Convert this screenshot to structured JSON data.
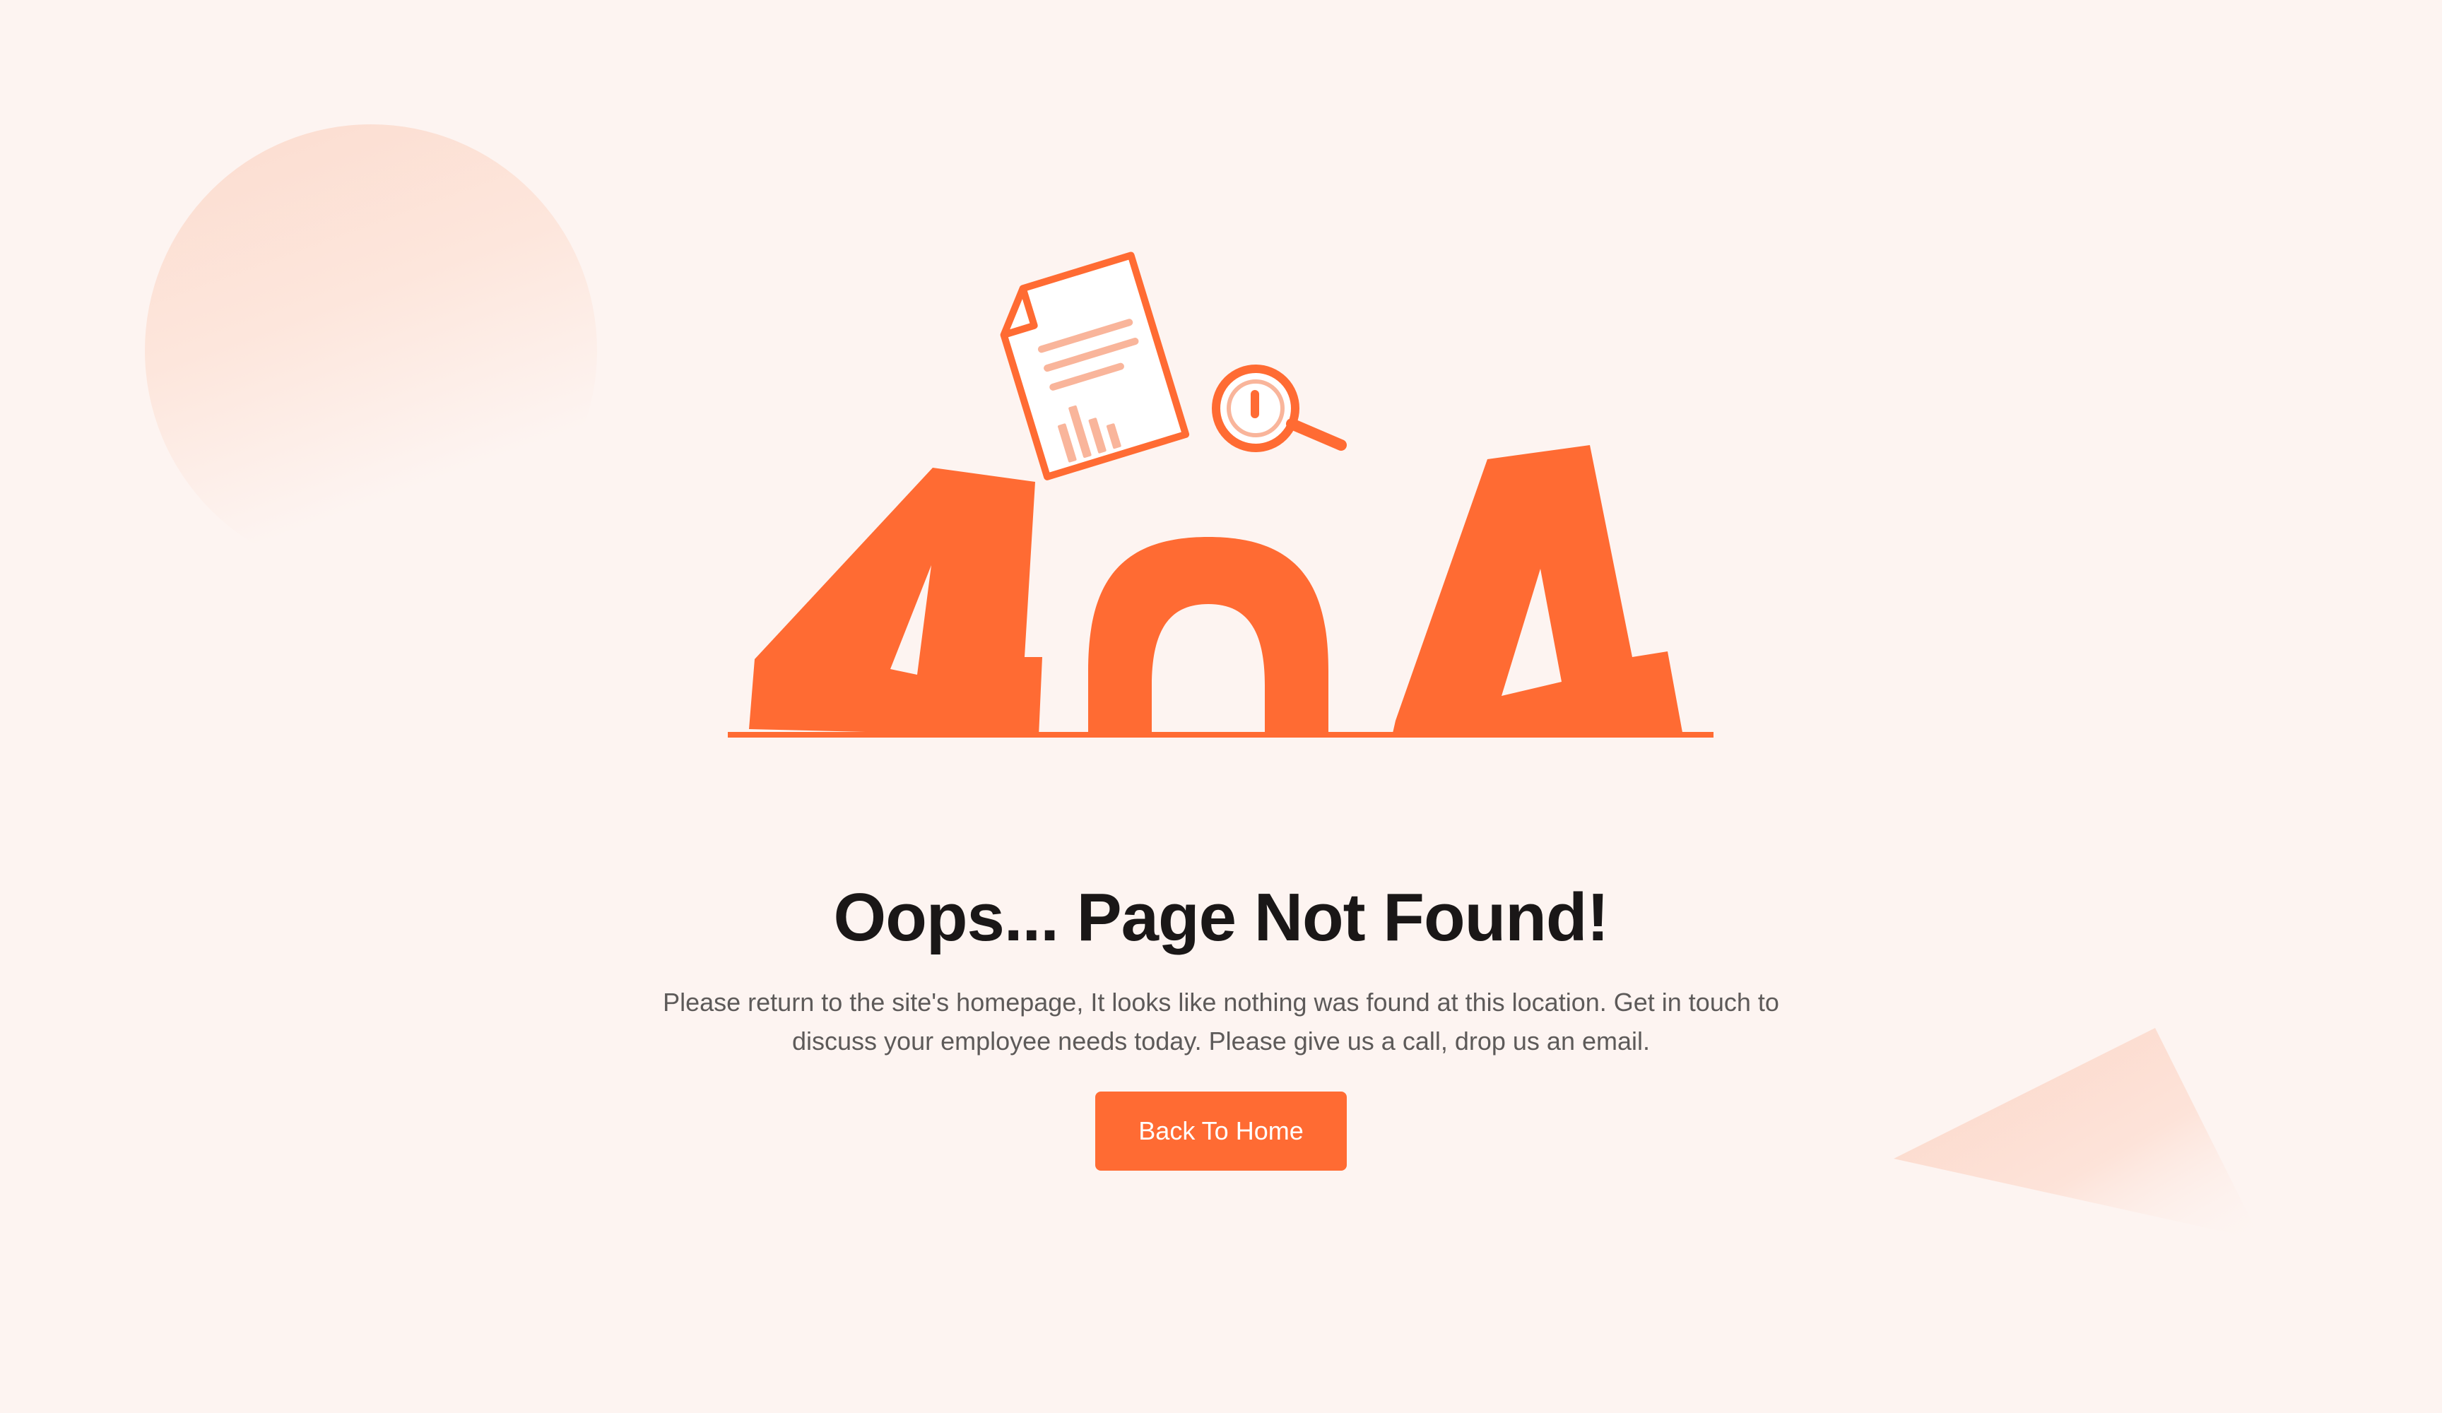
{
  "error": {
    "code_text": "404",
    "title": "Oops... Page Not Found!",
    "message": "Please return to the site's homepage, It looks like nothing was found at this location. Get in touch to discuss your employee needs today. Please give us a call, drop us an email.",
    "button_label": "Back To Home"
  },
  "illustration": {
    "icon": "document-search-icon"
  },
  "colors": {
    "accent": "#ff6b33",
    "accent_light": "#f9b59b",
    "background": "#fdf4f1",
    "title": "#1a1717",
    "body_text": "#5d5a59"
  }
}
